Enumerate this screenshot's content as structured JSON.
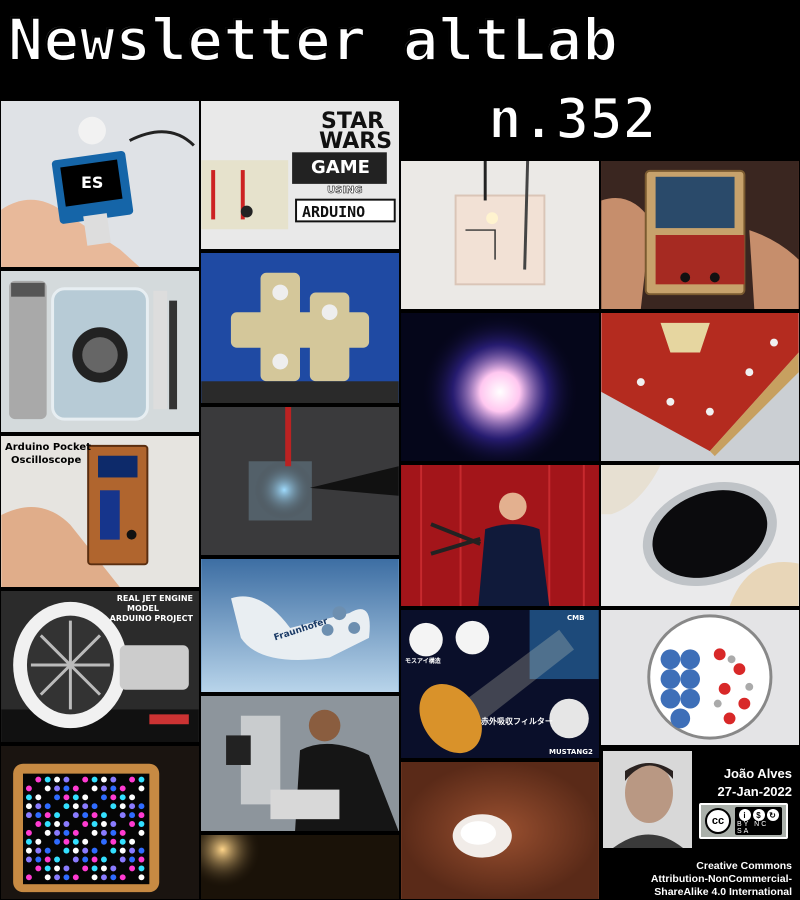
{
  "header": {
    "title": "Newsletter altLab",
    "issue": "n.352"
  },
  "tiles": {
    "t1": {
      "caption": "ES"
    },
    "t3": {
      "caption_line1": "Arduino Pocket",
      "caption_line2": "Oscilloscope"
    },
    "t4": {
      "caption_line1": "REAL JET ENGINE",
      "caption_line2": "MODEL",
      "caption_line3": "ARDUINO PROJECT"
    },
    "t6": {
      "line1": "STAR",
      "line2": "WARS",
      "line3": "GAME",
      "line4": "USING",
      "line5": "ARDUINO"
    },
    "t9": {
      "caption": "Fraunhofer"
    },
    "t15": {
      "label_top": "CMB",
      "label_bottom": "MUSTANG2",
      "jp_1": "モスアイ構造",
      "jp_2": "赤外吸収フィルター"
    }
  },
  "author": {
    "name": "João Alves",
    "date": "27-Jan-2022"
  },
  "license": {
    "badge_cc": "cc",
    "badge_icons": [
      "i",
      "$",
      "↻"
    ],
    "badge_abbr": "BY NC SA",
    "line1": "Creative Commons",
    "line2": "Attribution-NonCommercial-",
    "line3": "ShareAlike 4.0 International"
  }
}
